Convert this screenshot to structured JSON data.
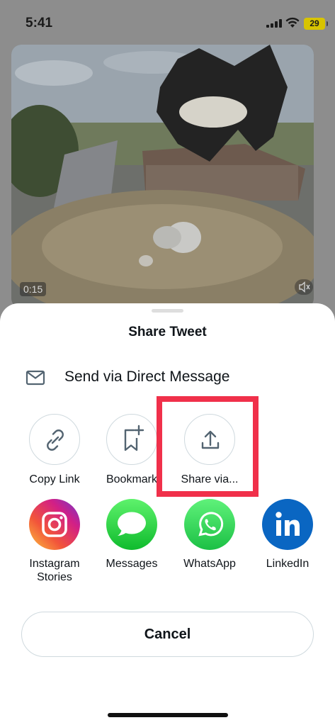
{
  "status_bar": {
    "time": "5:41",
    "battery_level": "29",
    "battery_color": "#d8c400"
  },
  "video": {
    "duration": "0:15",
    "mute_icon": "speaker-mute-icon"
  },
  "share_sheet": {
    "title": "Share Tweet",
    "direct_message": {
      "icon": "mail-icon",
      "label": "Send via Direct Message"
    },
    "actions": [
      {
        "icon": "link-icon",
        "label": "Copy Link"
      },
      {
        "icon": "bookmark-add-icon",
        "label": "Bookmark"
      },
      {
        "icon": "share-upload-icon",
        "label": "Share via..."
      }
    ],
    "apps": [
      {
        "icon": "instagram-icon",
        "label": "Instagram Stories"
      },
      {
        "icon": "messages-icon",
        "label": "Messages"
      },
      {
        "icon": "whatsapp-icon",
        "label": "WhatsApp"
      },
      {
        "icon": "linkedin-icon",
        "label": "LinkedIn"
      }
    ],
    "cancel_label": "Cancel",
    "highlight_color": "#f0304a"
  }
}
